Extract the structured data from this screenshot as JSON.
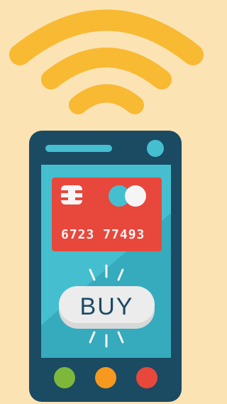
{
  "colors": {
    "background": "#FBE3B3",
    "wifi": "#F8B933",
    "phone_body": "#1B4A63",
    "screen": "#45BFD0",
    "screen_shade": "#35ABBD",
    "card": "#E8473C",
    "card_accent": "#F5F5F5",
    "speaker": "#45BFD0",
    "buy_button": "#ECECEC",
    "buy_button_shade": "#D8D8D8",
    "buy_text": "#1B4A63",
    "dot_green": "#7DB83B",
    "dot_orange": "#F6991E",
    "dot_red": "#E8473C"
  },
  "icons": {
    "wifi": "wifi-signal-icon",
    "chip": "card-chip-icon",
    "card_logo": "card-logo-icon",
    "camera": "camera-icon"
  },
  "card": {
    "number": "6723 77493"
  },
  "buy_button": {
    "label": "BUY"
  }
}
